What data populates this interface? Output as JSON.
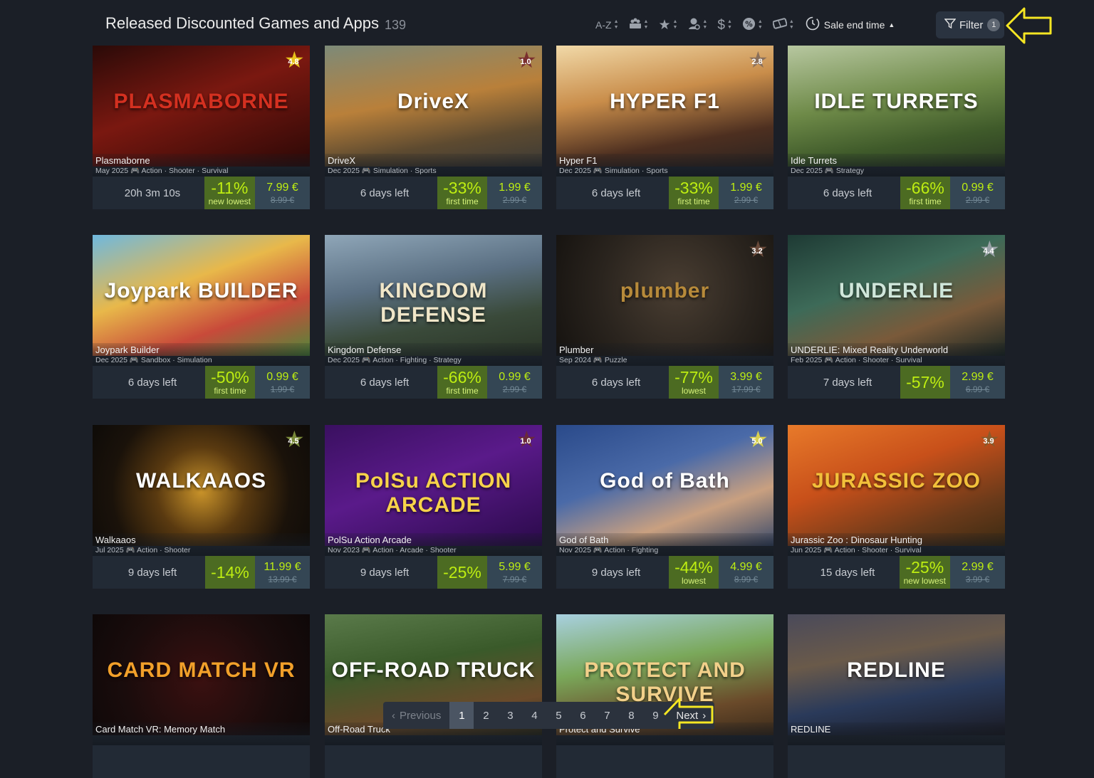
{
  "header": {
    "title": "Released Discounted Games and Apps",
    "count": "139",
    "sort_az": "A-Z",
    "sort_active": "Sale end time",
    "filter_label": "Filter",
    "filter_count": "1"
  },
  "sort_icons": [
    "users-icon",
    "star-icon",
    "reviewer-icon",
    "dollar-icon",
    "percent-badge-icon",
    "ticket-icon"
  ],
  "games": [
    {
      "art_text": "PLASMABORNE",
      "art_color": "#d43020",
      "bg": "linear-gradient(160deg,#2a0a08 0%,#7a1810 45%,#2b0806 100%)",
      "rating": "4.8",
      "rating_color": "#e8c21b",
      "name": "Plasmaborne",
      "date": "May 2025",
      "genres": "Action · Shooter · Survival",
      "time_left": "20h 3m 10s",
      "discount": "-11%",
      "discount_note": "new lowest",
      "price": "7.99 €",
      "old_price": "8.99 €"
    },
    {
      "art_text": "DriveX",
      "art_color": "#ffffff",
      "bg": "linear-gradient(170deg,#7d8a78 0%,#b9803a 45%,#5d4a30 75%,#3b3a36 100%)",
      "rating": "1.0",
      "rating_color": "#7a2f2f",
      "name": "DriveX",
      "date": "Dec 2025",
      "genres": "Simulation · Sports",
      "time_left": "6 days left",
      "discount": "-33%",
      "discount_note": "first time",
      "price": "1.99 €",
      "old_price": "2.99 €"
    },
    {
      "art_text": "HYPER F1",
      "art_color": "#ffffff",
      "bg": "linear-gradient(170deg,#f1d9a8 0%,#c98d4a 40%,#4d2f20 75%,#2a2320 100%)",
      "rating": "2.8",
      "rating_color": "#8a6f5a",
      "name": "Hyper F1",
      "date": "Dec 2025",
      "genres": "Simulation · Sports",
      "time_left": "6 days left",
      "discount": "-33%",
      "discount_note": "first time",
      "price": "1.99 €",
      "old_price": "2.99 €"
    },
    {
      "art_text": "IDLE TURRETS",
      "art_color": "#ffffff",
      "bg": "linear-gradient(170deg,#b7c7a0 0%,#6e8a48 45%,#3f5a2a 75%,#2b3b22 100%)",
      "rating": "",
      "rating_color": "#000000",
      "name": "Idle Turrets",
      "date": "Dec 2025",
      "genres": "Strategy",
      "time_left": "6 days left",
      "discount": "-66%",
      "discount_note": "first time",
      "price": "0.99 €",
      "old_price": "2.99 €"
    },
    {
      "art_text": "Joypark BUILDER",
      "art_color": "#ffffff",
      "bg": "linear-gradient(160deg,#6fb8de 0%,#e8b84a 40%,#c84a3a 70%,#4e8a3a 100%)",
      "rating": "",
      "rating_color": "#000000",
      "name": "Joypark Builder",
      "date": "Dec 2025",
      "genres": "Sandbox · Simulation",
      "time_left": "6 days left",
      "discount": "-50%",
      "discount_note": "first time",
      "price": "0.99 €",
      "old_price": "1.99 €"
    },
    {
      "art_text": "KINGDOM DEFENSE",
      "art_color": "#f0e6c8",
      "bg": "linear-gradient(170deg,#8fa6b8 0%,#5a6f82 40%,#3a4a3a 70%,#2a3426 100%)",
      "rating": "",
      "rating_color": "#000000",
      "name": "Kingdom Defense",
      "date": "Dec 2025",
      "genres": "Action · Fighting · Strategy",
      "time_left": "6 days left",
      "discount": "-66%",
      "discount_note": "first time",
      "price": "0.99 €",
      "old_price": "2.99 €"
    },
    {
      "art_text": "plumber",
      "art_color": "#b78a3a",
      "bg": "radial-gradient(circle at 55% 45%,#4a3e32 0%,#2a241e 55%,#15120f 100%)",
      "rating": "3.2",
      "rating_color": "#6a4a3a",
      "name": "Plumber",
      "date": "Sep 2024",
      "genres": "Puzzle",
      "time_left": "6 days left",
      "discount": "-77%",
      "discount_note": "lowest",
      "price": "3.99 €",
      "old_price": "17.99 €"
    },
    {
      "art_text": "UNDERLIE",
      "art_color": "#cfe6da",
      "bg": "linear-gradient(160deg,#1e3a34 0%,#3d6a58 40%,#7a5a3a 70%,#1a2622 100%)",
      "rating": "4.4",
      "rating_color": "#9aa3a8",
      "name": "UNDERLIE: Mixed Reality Underworld",
      "date": "Feb 2025",
      "genres": "Action · Shooter · Survival",
      "time_left": "7 days left",
      "discount": "-57%",
      "discount_note": "",
      "price": "2.99 €",
      "old_price": "6.99 €"
    },
    {
      "art_text": "WALKAAOS",
      "art_color": "#ffffff",
      "bg": "radial-gradient(circle at 50% 55%,#c9932a 0%,#5a3a10 35%,#1a120a 70%,#0e0b08 100%)",
      "rating": "4.5",
      "rating_color": "#7a8a3a",
      "name": "Walkaaos",
      "date": "Jul 2025",
      "genres": "Action · Shooter",
      "time_left": "9 days left",
      "discount": "-14%",
      "discount_note": "",
      "price": "11.99 €",
      "old_price": "13.99 €"
    },
    {
      "art_text": "PolSu ACTION ARCADE",
      "art_color": "#f7d34a",
      "bg": "linear-gradient(160deg,#3a1060 0%,#5a1a8a 45%,#2a0a4a 100%)",
      "rating": "1.0",
      "rating_color": "#6a2a3a",
      "name": "PolSu Action Arcade",
      "date": "Nov 2023",
      "genres": "Action · Arcade · Shooter",
      "time_left": "9 days left",
      "discount": "-25%",
      "discount_note": "",
      "price": "5.99 €",
      "old_price": "7.99 €"
    },
    {
      "art_text": "God of Bath",
      "art_color": "#ffffff",
      "bg": "linear-gradient(160deg,#2a4a8a 0%,#4a6aa8 40%,#c9a080 70%,#3a4a6a 100%)",
      "rating": "5.0",
      "rating_color": "#d8d050",
      "name": "God of Bath",
      "date": "Nov 2025",
      "genres": "Action · Fighting",
      "time_left": "9 days left",
      "discount": "-44%",
      "discount_note": "lowest",
      "price": "4.99 €",
      "old_price": "8.99 €"
    },
    {
      "art_text": "JURASSIC ZOO",
      "art_color": "#f2c03a",
      "bg": "linear-gradient(160deg,#e87a2a 0%,#c8501a 40%,#6a3a1a 75%,#3a2a12 100%)",
      "rating": "3.9",
      "rating_color": "#8a5a2a",
      "name": "Jurassic Zoo : Dinosaur Hunting",
      "date": "Jun 2025",
      "genres": "Action · Shooter · Survival",
      "time_left": "15 days left",
      "discount": "-25%",
      "discount_note": "new lowest",
      "price": "2.99 €",
      "old_price": "3.99 €"
    },
    {
      "art_text": "CARD MATCH VR",
      "art_color": "#f2a02a",
      "bg": "radial-gradient(circle at 50% 55%,#3a1010 0%,#1a0c0c 60%,#0e0808 100%)",
      "rating": "",
      "rating_color": "#000000",
      "name": "Card Match VR: Memory Match",
      "date": "",
      "genres": "",
      "time_left": "",
      "discount": "",
      "discount_note": "",
      "price": "",
      "old_price": ""
    },
    {
      "art_text": "OFF-ROAD TRUCK",
      "art_color": "#ffffff",
      "bg": "linear-gradient(170deg,#5a7a4a 0%,#3a5a2a 40%,#6a4a2a 75%,#2a2a1a 100%)",
      "rating": "",
      "rating_color": "#000000",
      "name": "Off-Road Truck",
      "date": "",
      "genres": "",
      "time_left": "",
      "discount": "",
      "discount_note": "",
      "price": "",
      "old_price": ""
    },
    {
      "art_text": "PROTECT AND SURVIVE",
      "art_color": "#f2d08a",
      "bg": "linear-gradient(170deg,#a8d0e0 0%,#7aa85a 40%,#6a4a2a 75%,#3a2a1a 100%)",
      "rating": "",
      "rating_color": "#000000",
      "name": "Protect and Survive",
      "date": "",
      "genres": "",
      "time_left": "",
      "discount": "",
      "discount_note": "",
      "price": "",
      "old_price": ""
    },
    {
      "art_text": "REDLINE",
      "art_color": "#ffffff",
      "bg": "linear-gradient(170deg,#4a4a5a 0%,#6a5a4a 35%,#2a3a5a 65%,#1a1a22 100%)",
      "rating": "",
      "rating_color": "#000000",
      "name": "REDLINE",
      "date": "",
      "genres": "",
      "time_left": "",
      "discount": "",
      "discount_note": "",
      "price": "",
      "old_price": ""
    }
  ],
  "pagination": {
    "previous": "Previous",
    "pages": [
      "1",
      "2",
      "3",
      "4",
      "5",
      "6",
      "7",
      "8",
      "9"
    ],
    "current": "1",
    "next": "Next"
  },
  "callout_color": "#f5e623"
}
